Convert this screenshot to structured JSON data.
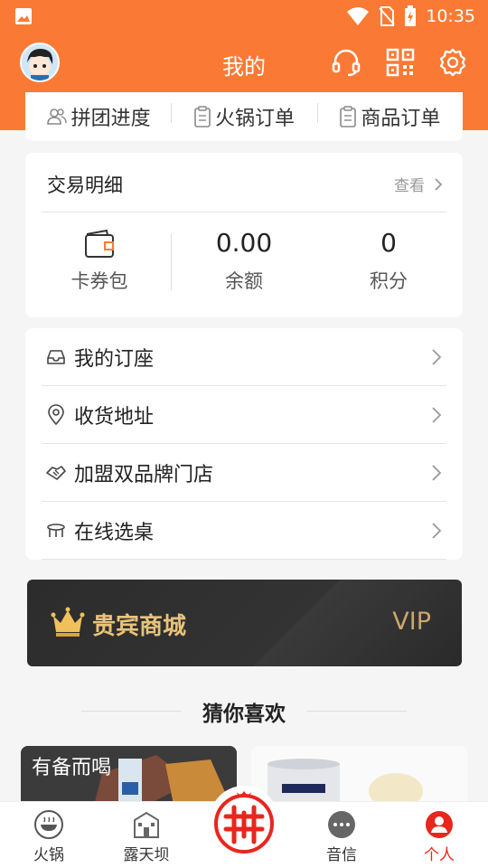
{
  "status_bar": {
    "time": "10:35",
    "icons": [
      "image-icon",
      "wifi-icon",
      "no-sim-icon",
      "battery-charging-icon"
    ]
  },
  "header": {
    "title": "我的",
    "icons": [
      "headset-icon",
      "qr-code-icon",
      "gear-icon"
    ]
  },
  "order_tabs": [
    {
      "label": "拼团进度",
      "icon": "group-icon"
    },
    {
      "label": "火锅订单",
      "icon": "clipboard-icon"
    },
    {
      "label": "商品订单",
      "icon": "clipboard-icon"
    }
  ],
  "transactions": {
    "title": "交易明细",
    "more_label": "查看",
    "wallet_label": "卡券包",
    "balance_value": "0.00",
    "balance_label": "余额",
    "points_value": "0",
    "points_label": "积分"
  },
  "menu": [
    {
      "label": "我的订座",
      "icon": "inbox-icon"
    },
    {
      "label": "收货地址",
      "icon": "location-pin-icon"
    },
    {
      "label": "加盟双品牌门店",
      "icon": "handshake-icon"
    },
    {
      "label": "在线选桌",
      "icon": "table-icon"
    }
  ],
  "vip": {
    "title": "贵宾商城",
    "tag": "VIP"
  },
  "guess": {
    "title": "猜你喜欢",
    "product1_caption": "有备而喝"
  },
  "bottom_nav": [
    {
      "label": "火锅",
      "icon": "hotpot-icon"
    },
    {
      "label": "露天坝",
      "icon": "building-icon"
    },
    {
      "label": "拼",
      "icon": "pin-logo-icon"
    },
    {
      "label": "音信",
      "icon": "chat-bubble-icon"
    },
    {
      "label": "个人",
      "icon": "person-icon"
    }
  ],
  "colors": {
    "brand": "#fa7a35",
    "accent_red": "#e8261d",
    "vip_gold": "#e8c37a"
  }
}
